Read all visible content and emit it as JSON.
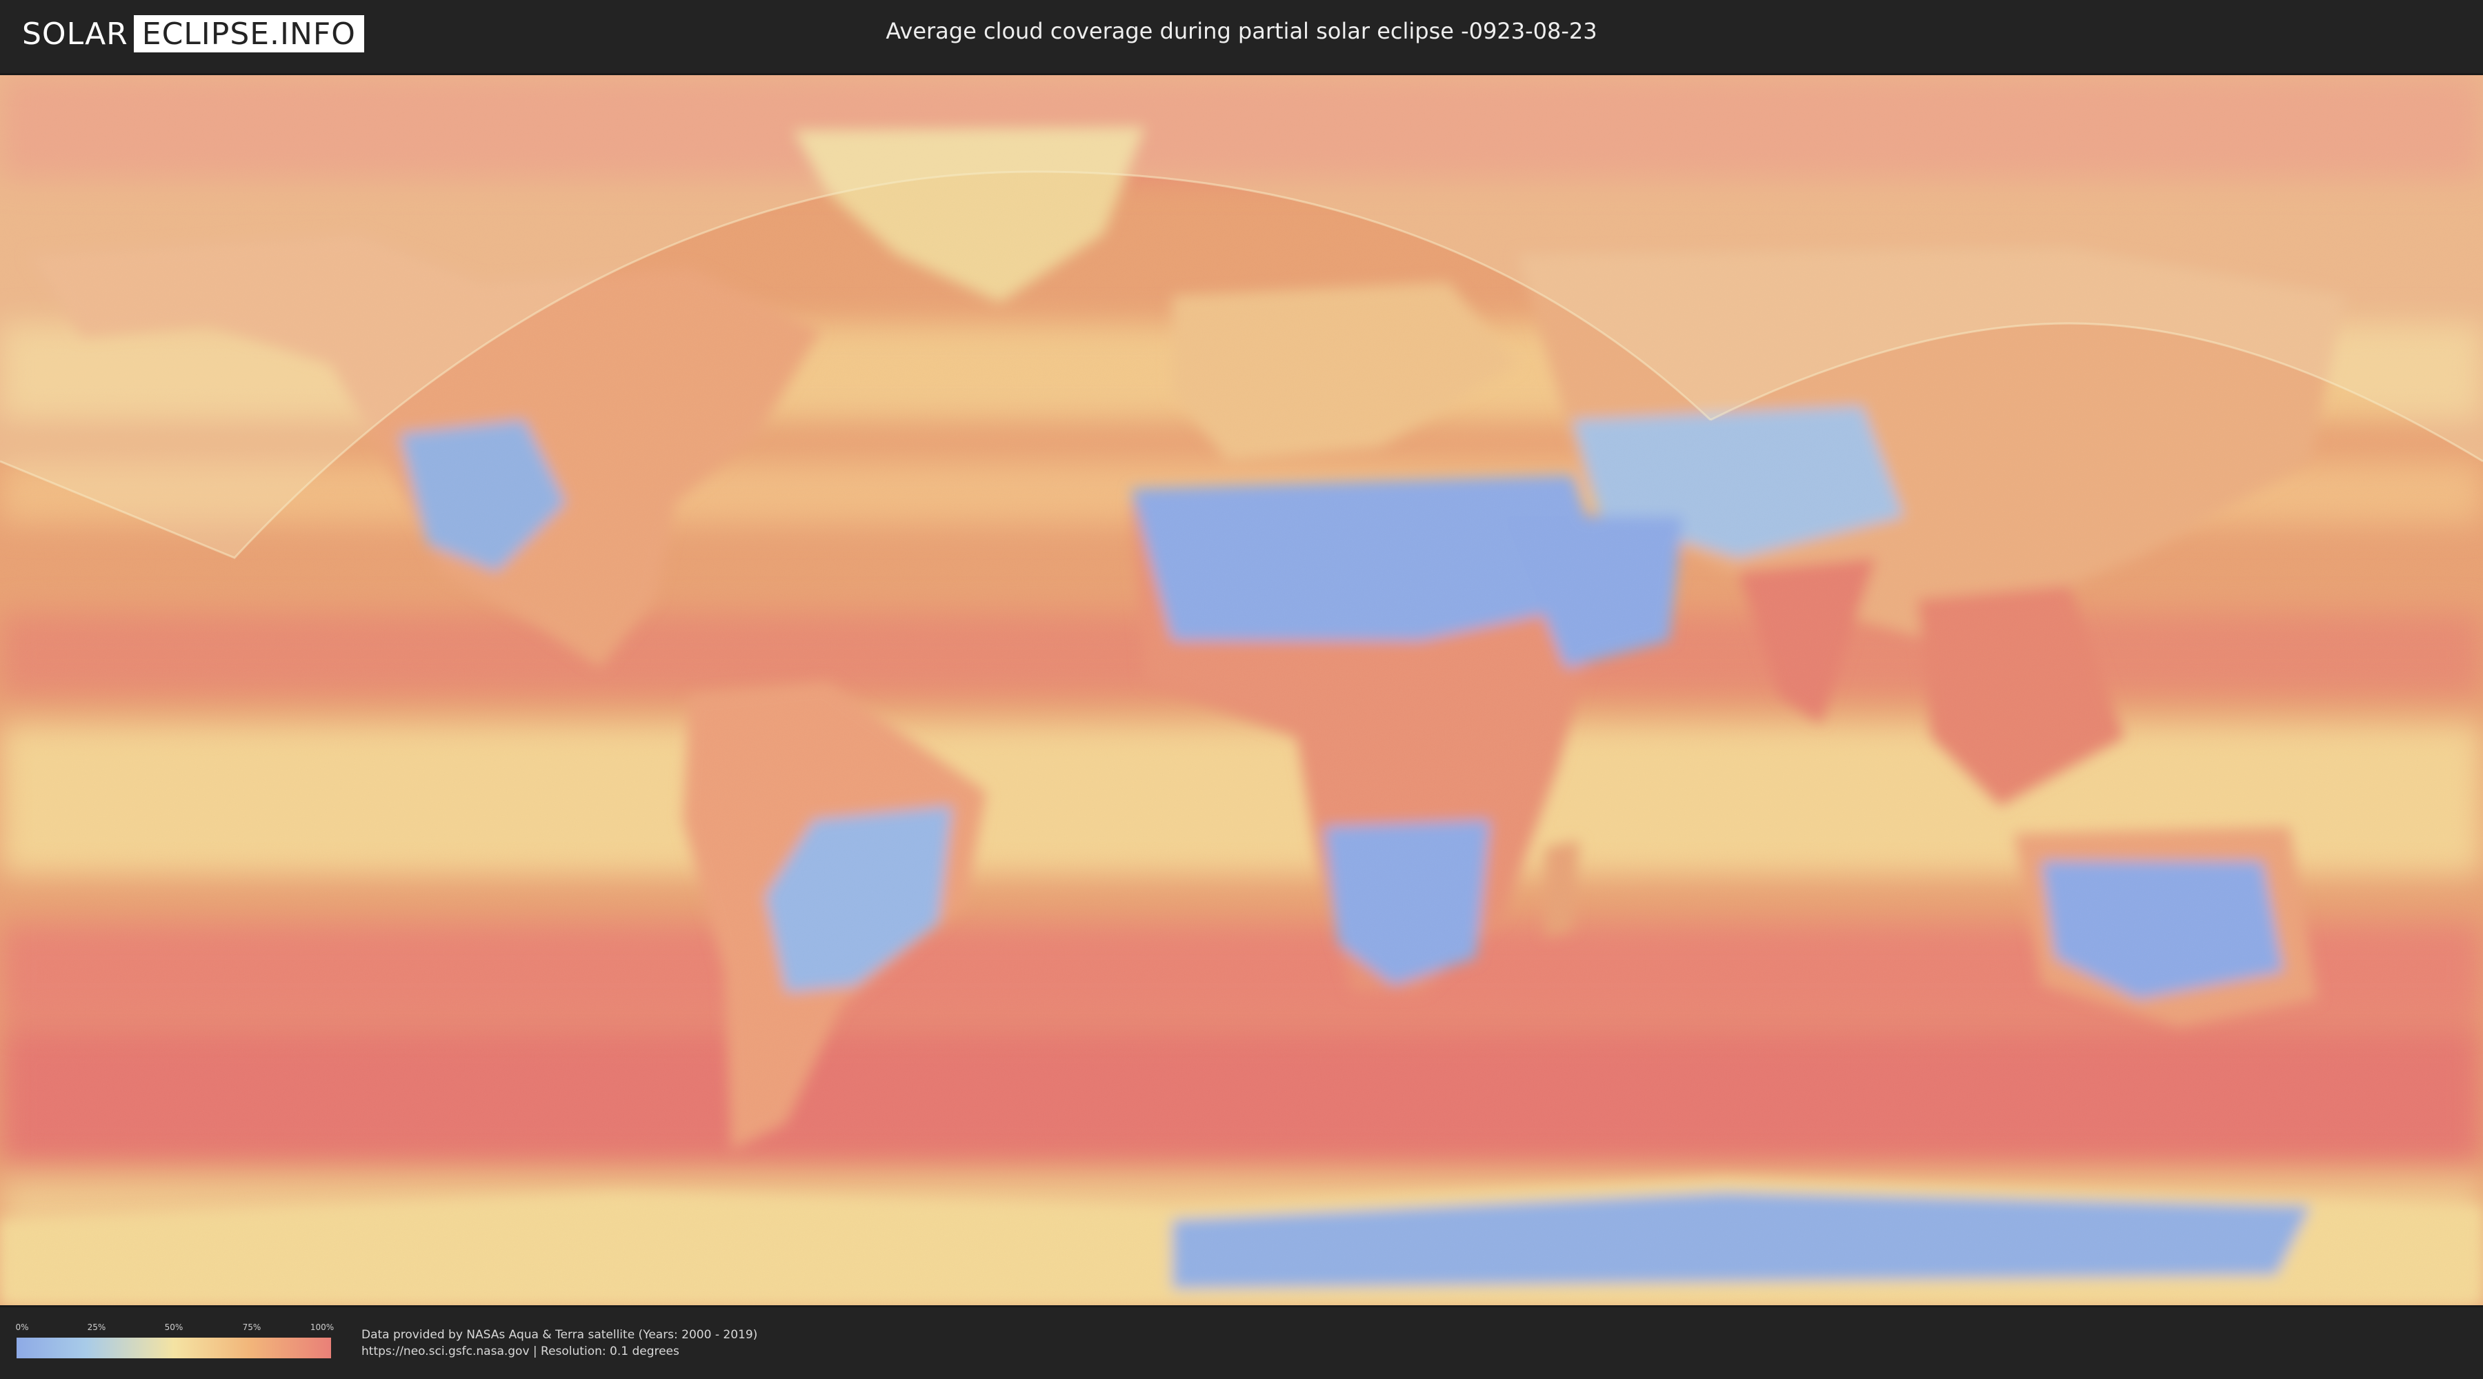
{
  "header": {
    "logo_solar": "SOLAR",
    "logo_eclipse": "ECLIPSE.INFO",
    "title": "Average cloud coverage during partial solar eclipse -0923-08-23"
  },
  "legend": {
    "ticks": [
      "0%",
      "25%",
      "50%",
      "75%",
      "100%"
    ],
    "colors": [
      "#8eaae6",
      "#a8cbe8",
      "#f4e3a3",
      "#f2b67a",
      "#e98078"
    ]
  },
  "footer": {
    "credit_line_1": "Data provided by NASAs Aqua & Terra satellite (Years: 2000 - 2019)",
    "credit_line_2": "https://neo.sci.gsfc.nasa.gov | Resolution: 0.1 degrees"
  },
  "map": {
    "ocean_color": "#e69a73",
    "high_cloud_color": "#e6786f",
    "clear_sky_color": "#8eaae6",
    "eclipse_overlay_color": "#fbeec0"
  }
}
